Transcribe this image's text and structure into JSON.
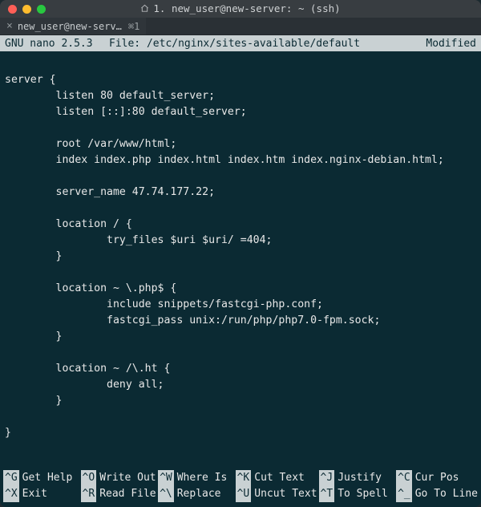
{
  "window": {
    "title_prefix": "1.",
    "title": "new_user@new-server: ~ (ssh)"
  },
  "tab": {
    "close_glyph": "×",
    "label": "new_user@new-serv…",
    "shortcut": "⌘1"
  },
  "nano": {
    "app_label": "GNU nano 2.5.3",
    "file_label": "File: /etc/nginx/sites-available/default",
    "status": "Modified"
  },
  "editor_lines": [
    "",
    "server {",
    "        listen 80 default_server;",
    "        listen [::]:80 default_server;",
    "",
    "        root /var/www/html;",
    "        index index.php index.html index.htm index.nginx-debian.html;",
    "",
    "        server_name 47.74.177.22;",
    "",
    "        location / {",
    "                try_files $uri $uri/ =404;",
    "        }",
    "",
    "        location ~ \\.php$ {",
    "                include snippets/fastcgi-php.conf;",
    "                fastcgi_pass unix:/run/php/php7.0-fpm.sock;",
    "        }",
    "",
    "        location ~ /\\.ht {",
    "                deny all;",
    "        }",
    "",
    "}"
  ],
  "shortcuts_row1": [
    {
      "key": "^G",
      "label": "Get Help"
    },
    {
      "key": "^O",
      "label": "Write Out"
    },
    {
      "key": "^W",
      "label": "Where Is"
    },
    {
      "key": "^K",
      "label": "Cut Text"
    },
    {
      "key": "^J",
      "label": "Justify"
    },
    {
      "key": "^C",
      "label": "Cur Pos"
    }
  ],
  "shortcuts_row2": [
    {
      "key": "^X",
      "label": "Exit"
    },
    {
      "key": "^R",
      "label": "Read File"
    },
    {
      "key": "^\\",
      "label": "Replace"
    },
    {
      "key": "^U",
      "label": "Uncut Text"
    },
    {
      "key": "^T",
      "label": "To Spell"
    },
    {
      "key": "^_",
      "label": "Go To Line"
    }
  ]
}
